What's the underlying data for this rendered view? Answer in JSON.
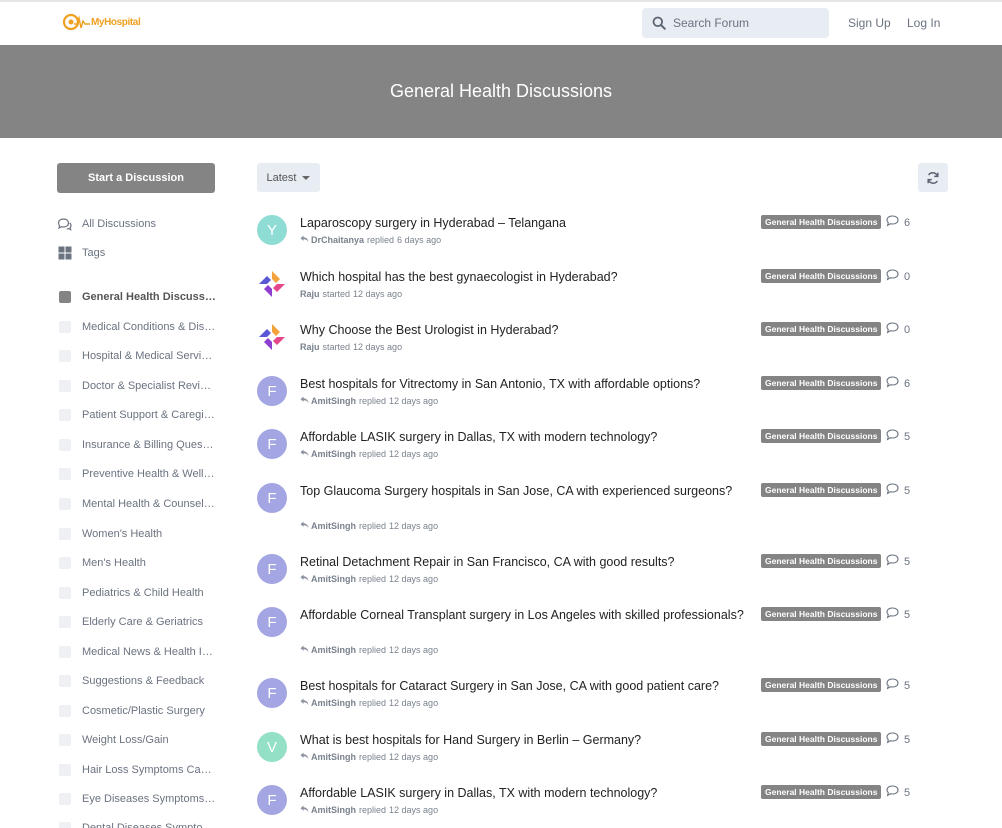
{
  "header": {
    "logo_text": "MyHospital",
    "search_placeholder": "Search Forum",
    "signup_label": "Sign Up",
    "login_label": "Log In"
  },
  "hero": {
    "title": "General Health Discussions"
  },
  "sidebar": {
    "start_label": "Start a Discussion",
    "nav": [
      {
        "label": "All Discussions",
        "icon": "comments-icon"
      },
      {
        "label": "Tags",
        "icon": "tags-grid-icon"
      }
    ],
    "tags": [
      {
        "label": "General Health Discussions",
        "active": true
      },
      {
        "label": "Medical Conditions & Diseases"
      },
      {
        "label": "Hospital & Medical Services"
      },
      {
        "label": "Doctor & Specialist Reviews"
      },
      {
        "label": "Patient Support & Caregiving"
      },
      {
        "label": "Insurance & Billing Questions"
      },
      {
        "label": "Preventive Health & Wellness"
      },
      {
        "label": "Mental Health & Counseling"
      },
      {
        "label": "Women's Health"
      },
      {
        "label": "Men's Health"
      },
      {
        "label": "Pediatrics & Child Health"
      },
      {
        "label": "Elderly Care & Geriatrics"
      },
      {
        "label": "Medical News & Health Insights"
      },
      {
        "label": "Suggestions & Feedback"
      },
      {
        "label": "Cosmetic/Plastic Surgery"
      },
      {
        "label": "Weight Loss/Gain"
      },
      {
        "label": "Hair Loss Symptoms Causes"
      },
      {
        "label": "Eye Diseases Symptoms Causes"
      },
      {
        "label": "Dental Diseases Symptoms"
      }
    ]
  },
  "toolbar": {
    "sort_label": "Latest"
  },
  "colors": {
    "accent": "#848484",
    "logo_orange": "#f0a020",
    "avatar_purple": "#a3a6e3",
    "avatar_teal": "#8fdcd4",
    "avatar_green": "#93e0c6"
  },
  "discussions": [
    {
      "avatar": "Y",
      "avatar_color": "#8fdcd4",
      "title": "Laparoscopy surgery in Hyderabad – Telangana",
      "author": "DrChaitanya",
      "verb": "replied",
      "time": "6 days ago",
      "reply_icon": true,
      "tag": "General Health Discussions",
      "replies": "6"
    },
    {
      "avatar": "",
      "avatar_logo": true,
      "title": "Which hospital has the best gynaecologist in Hyderabad?",
      "author": "Raju",
      "verb": "started",
      "time": "12 days ago",
      "reply_icon": false,
      "tag": "General Health Discussions",
      "replies": "0"
    },
    {
      "avatar": "",
      "avatar_logo": true,
      "title": "Why Choose the Best Urologist in Hyderabad?",
      "author": "Raju",
      "verb": "started",
      "time": "12 days ago",
      "reply_icon": false,
      "tag": "General Health Discussions",
      "replies": "0"
    },
    {
      "avatar": "F",
      "avatar_color": "#a3a6e3",
      "title": "Best hospitals for Vitrectomy in San Antonio, TX with affordable options?",
      "author": "AmitSingh",
      "verb": "replied",
      "time": "12 days ago",
      "reply_icon": true,
      "tag": "General Health Discussions",
      "replies": "6"
    },
    {
      "avatar": "F",
      "avatar_color": "#a3a6e3",
      "title": "Affordable LASIK surgery in Dallas, TX with modern technology?",
      "author": "AmitSingh",
      "verb": "replied",
      "time": "12 days ago",
      "reply_icon": true,
      "tag": "General Health Discussions",
      "replies": "5"
    },
    {
      "avatar": "F",
      "avatar_color": "#a3a6e3",
      "title": "Top Glaucoma Surgery hospitals in San Jose, CA with experienced surgeons?",
      "author": "AmitSingh",
      "verb": "replied",
      "time": "12 days ago",
      "reply_icon": true,
      "tag": "General Health Discussions",
      "replies": "5"
    },
    {
      "avatar": "F",
      "avatar_color": "#a3a6e3",
      "title": "Retinal Detachment Repair in San Francisco, CA with good results?",
      "author": "AmitSingh",
      "verb": "replied",
      "time": "12 days ago",
      "reply_icon": true,
      "tag": "General Health Discussions",
      "replies": "5"
    },
    {
      "avatar": "F",
      "avatar_color": "#a3a6e3",
      "title": "Affordable Corneal Transplant surgery in Los Angeles with skilled professionals?",
      "author": "AmitSingh",
      "verb": "replied",
      "time": "12 days ago",
      "reply_icon": true,
      "tag": "General Health Discussions",
      "replies": "5"
    },
    {
      "avatar": "F",
      "avatar_color": "#a3a6e3",
      "title": "Best hospitals for Cataract Surgery in San Jose, CA with good patient care?",
      "author": "AmitSingh",
      "verb": "replied",
      "time": "12 days ago",
      "reply_icon": true,
      "tag": "General Health Discussions",
      "replies": "5"
    },
    {
      "avatar": "V",
      "avatar_color": "#93e0c6",
      "title": "What is best hospitals for Hand Surgery in Berlin – Germany?",
      "author": "AmitSingh",
      "verb": "replied",
      "time": "12 days ago",
      "reply_icon": true,
      "tag": "General Health Discussions",
      "replies": "5"
    },
    {
      "avatar": "F",
      "avatar_color": "#a3a6e3",
      "title": "Affordable LASIK surgery in Dallas, TX with modern technology?",
      "author": "AmitSingh",
      "verb": "replied",
      "time": "12 days ago",
      "reply_icon": true,
      "tag": "General Health Discussions",
      "replies": "5"
    }
  ]
}
